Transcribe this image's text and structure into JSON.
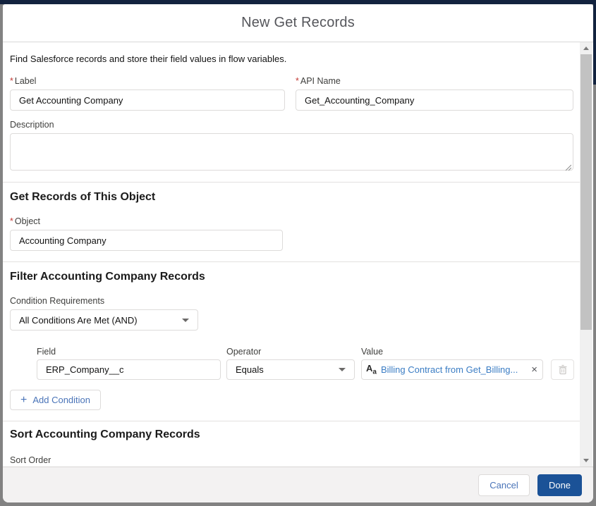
{
  "modal": {
    "title": "New Get Records",
    "intro": "Find Salesforce records and store their field values in flow variables.",
    "required_marker": "*",
    "fields": {
      "label": {
        "label": "Label",
        "value": "Get Accounting Company"
      },
      "api_name": {
        "label": "API Name",
        "value": "Get_Accounting_Company"
      },
      "description": {
        "label": "Description",
        "value": ""
      }
    },
    "object_section": {
      "heading": "Get Records of This Object",
      "object": {
        "label": "Object",
        "value": "Accounting Company"
      }
    },
    "filter_section": {
      "heading": "Filter Accounting Company Records",
      "condition_requirements": {
        "label": "Condition Requirements",
        "value": "All Conditions Are Met (AND)"
      },
      "condition_row": {
        "field_label": "Field",
        "operator_label": "Operator",
        "value_label": "Value",
        "field_value": "ERP_Company__c",
        "operator_value": "Equals",
        "value_pill_text": "Billing Contract from Get_Billing...",
        "remove_glyph": "×"
      },
      "add_condition": {
        "plus_glyph": "+",
        "label": "Add Condition"
      }
    },
    "sort_section": {
      "heading": "Sort Accounting Company Records",
      "sort_order_label": "Sort Order"
    },
    "footer": {
      "cancel_label": "Cancel",
      "done_label": "Done"
    }
  },
  "colors": {
    "brand_button": "#1b5297",
    "link_blue": "#4a74b8",
    "pill_blue": "#3b7dc4",
    "required_red": "#c23934",
    "top_edge_navy": "#13233f"
  }
}
